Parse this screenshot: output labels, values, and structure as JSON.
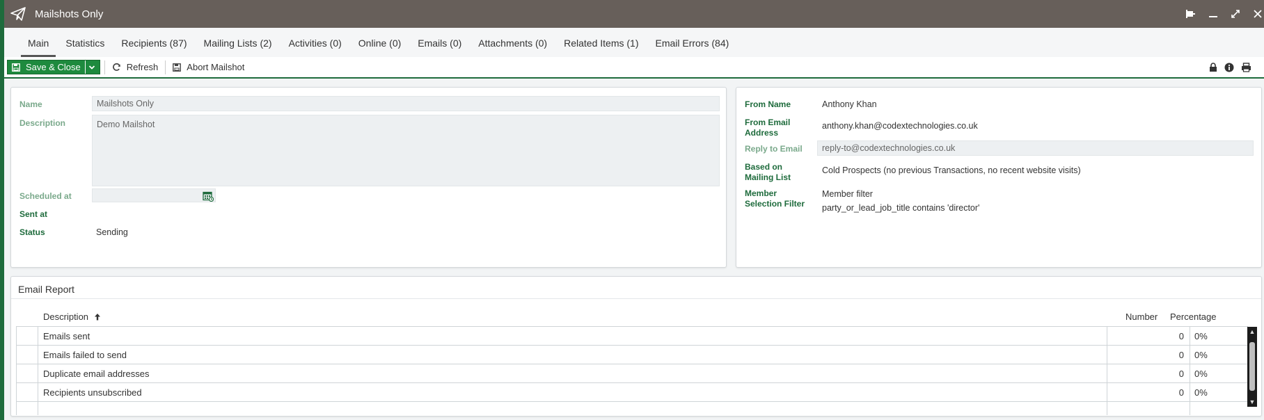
{
  "window": {
    "title": "Mailshots Only"
  },
  "tabs": [
    {
      "label": "Main"
    },
    {
      "label": "Statistics"
    },
    {
      "label": "Recipients (87)"
    },
    {
      "label": "Mailing Lists (2)"
    },
    {
      "label": "Activities (0)"
    },
    {
      "label": "Online (0)"
    },
    {
      "label": "Emails (0)"
    },
    {
      "label": "Attachments (0)"
    },
    {
      "label": "Related Items (1)"
    },
    {
      "label": "Email Errors (84)"
    }
  ],
  "toolbar": {
    "save_close": "Save & Close",
    "refresh": "Refresh",
    "abort": "Abort Mailshot"
  },
  "left": {
    "name_label": "Name",
    "name_value": "Mailshots Only",
    "description_label": "Description",
    "description_value": "Demo Mailshot",
    "scheduled_label": "Scheduled at",
    "scheduled_value": "",
    "sent_label": "Sent at",
    "sent_value": "",
    "status_label": "Status",
    "status_value": "Sending"
  },
  "right": {
    "from_name_label": "From Name",
    "from_name_value": "Anthony Khan",
    "from_email_label_1": "From Email",
    "from_email_label_2": "Address",
    "from_email_value": "anthony.khan@codextechnologies.co.uk",
    "reply_to_label": "Reply to Email",
    "reply_to_value": "reply-to@codextechnologies.co.uk",
    "based_on_label_1": "Based on",
    "based_on_label_2": "Mailing List",
    "based_on_value": "Cold Prospects (no previous Transactions, no recent website visits)",
    "member_label_1": "Member",
    "member_label_2": "Selection Filter",
    "member_filter_title": "Member filter",
    "member_filter_value": "party_or_lead_job_title contains 'director'"
  },
  "report": {
    "title": "Email Report",
    "columns": {
      "description": "Description",
      "number": "Number",
      "percentage": "Percentage"
    },
    "rows": [
      {
        "description": "Emails sent",
        "number": "0",
        "percentage": "0%"
      },
      {
        "description": "Emails failed to send",
        "number": "0",
        "percentage": "0%"
      },
      {
        "description": "Duplicate email addresses",
        "number": "0",
        "percentage": "0%"
      },
      {
        "description": "Recipients unsubscribed",
        "number": "0",
        "percentage": "0%"
      }
    ]
  },
  "colors": {
    "brand_green": "#1e6b3c",
    "titlebar": "#675f5a",
    "save_button": "#1e8a3e"
  }
}
